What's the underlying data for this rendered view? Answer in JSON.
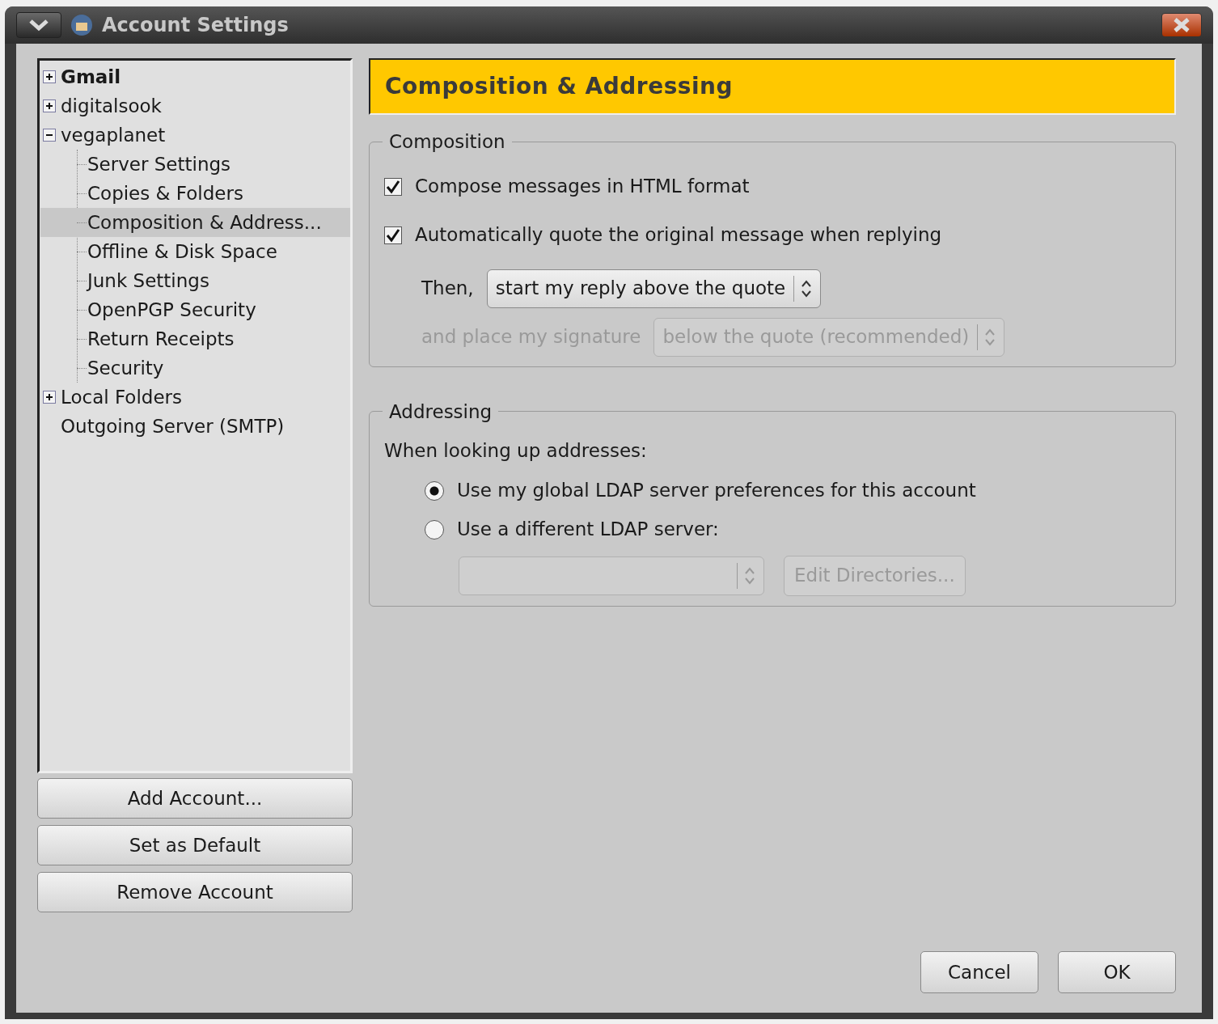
{
  "window": {
    "title": "Account Settings"
  },
  "tree": [
    {
      "label": "Gmail",
      "default": true,
      "expanded": false,
      "selected": false
    },
    {
      "label": "digitalsook",
      "default": false,
      "expanded": false,
      "selected": false
    },
    {
      "label": "vegaplanet",
      "default": false,
      "expanded": true,
      "selected": false,
      "children": [
        {
          "label": "Server Settings",
          "selected": false
        },
        {
          "label": "Copies & Folders",
          "selected": false
        },
        {
          "label": "Composition & Address...",
          "selected": true
        },
        {
          "label": "Offline & Disk Space",
          "selected": false
        },
        {
          "label": "Junk Settings",
          "selected": false
        },
        {
          "label": "OpenPGP Security",
          "selected": false
        },
        {
          "label": "Return Receipts",
          "selected": false
        },
        {
          "label": "Security",
          "selected": false
        }
      ]
    },
    {
      "label": "Local Folders",
      "default": false,
      "expanded": false,
      "selected": false
    },
    {
      "label": "Outgoing Server (SMTP)",
      "default": false,
      "selected": false
    }
  ],
  "account_buttons": [
    "Add Account...",
    "Set as Default",
    "Remove Account"
  ],
  "panel": {
    "header": "Composition & Addressing",
    "composition": {
      "legend": "Composition",
      "checkboxes": [
        {
          "label": "Compose messages in HTML format",
          "checked": true
        },
        {
          "label": "Automatically quote the original message when replying",
          "checked": true
        }
      ],
      "reply": {
        "label": "Then,",
        "value": "start my reply above the quote",
        "disabled": false
      },
      "signature": {
        "label": "and place my signature",
        "value": "below the quote (recommended)",
        "disabled": true
      }
    },
    "addressing": {
      "legend": "Addressing",
      "prompt": "When looking up addresses:",
      "radios": [
        {
          "label": "Use my global LDAP server preferences for this account",
          "selected": true
        },
        {
          "label": "Use a different LDAP server:",
          "selected": false
        }
      ],
      "ldap_select": {
        "disabled": true
      },
      "edit_button": {
        "label": "Edit Directories...",
        "disabled": true
      }
    }
  },
  "dialog_buttons": [
    "Cancel",
    "OK"
  ]
}
